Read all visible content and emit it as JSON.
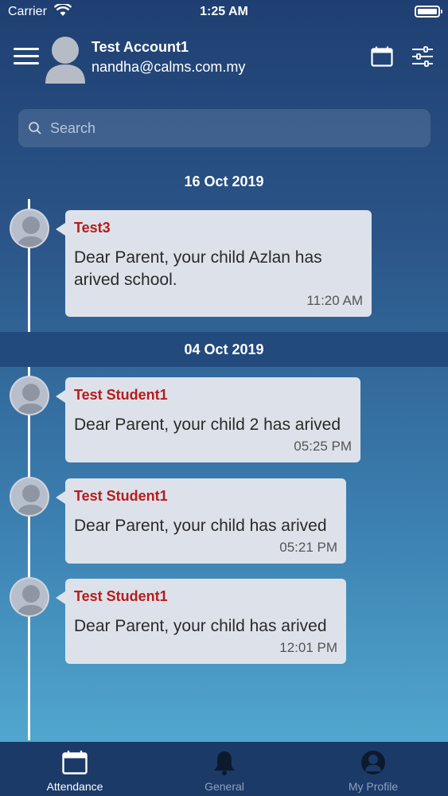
{
  "status_bar": {
    "carrier": "Carrier",
    "time": "1:25 AM"
  },
  "header": {
    "account_name": "Test Account1",
    "account_email": "nandha@calms.com.my",
    "menu_icon": "hamburger-menu-icon",
    "calendar_icon": "calendar-icon",
    "filter_icon": "sliders-icon"
  },
  "search": {
    "placeholder": "Search",
    "value": ""
  },
  "groups": [
    {
      "date": "16 Oct 2019",
      "items": [
        {
          "sender": "Test3",
          "message": "Dear Parent, your child Azlan has arived school.",
          "time": "11:20 AM"
        }
      ]
    },
    {
      "date": "04 Oct 2019",
      "items": [
        {
          "sender": "Test Student1",
          "message": "Dear Parent, your child 2 has arived",
          "time": "05:25 PM"
        },
        {
          "sender": "Test Student1",
          "message": "Dear Parent, your child has arived",
          "time": "05:21 PM"
        },
        {
          "sender": "Test Student1",
          "message": "Dear Parent, your child has arived",
          "time": "12:01 PM"
        }
      ]
    }
  ],
  "tabs": [
    {
      "label": "Attendance",
      "icon": "calendar-icon",
      "active": true
    },
    {
      "label": "General",
      "icon": "bell-icon",
      "active": false
    },
    {
      "label": "My Profile",
      "icon": "profile-icon",
      "active": false
    }
  ],
  "colors": {
    "sender": "#b71c1c",
    "tabbar": "#1b3a68",
    "date_band": "#234a7d",
    "bubble": "#dde2ea"
  }
}
